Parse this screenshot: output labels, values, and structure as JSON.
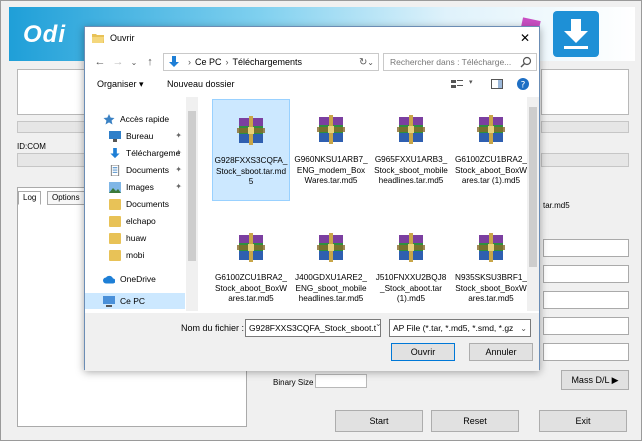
{
  "odin": {
    "logo": "Odi",
    "id_com": "ID:COM",
    "tabs": [
      "Log",
      "Options"
    ],
    "file_suffix": "tar.md5",
    "binary_size_label": "Binary Size",
    "mass_dl_label": "Mass D/L ▶",
    "start": "Start",
    "reset": "Reset",
    "exit": "Exit"
  },
  "dialog": {
    "title": "Ouvrir",
    "close": "✕",
    "nav": {
      "back": "←",
      "forward": "→",
      "up": "↑",
      "recent": "⌄",
      "path": [
        "Ce PC",
        "Téléchargements"
      ],
      "search_placeholder": "Rechercher dans : Télécharge..."
    },
    "toolbar": {
      "organize": "Organiser ▾",
      "new_folder": "Nouveau dossier"
    },
    "sidebar": [
      {
        "label": "Accès rapide",
        "icon": "star-icon",
        "pinned": false
      },
      {
        "label": "Bureau",
        "icon": "desktop-icon",
        "pinned": true
      },
      {
        "label": "Téléchargeme",
        "icon": "download-icon",
        "pinned": true
      },
      {
        "label": "Documents",
        "icon": "documents-icon",
        "pinned": true
      },
      {
        "label": "Images",
        "icon": "images-icon",
        "pinned": true
      },
      {
        "label": "Documents",
        "icon": "folder-icon",
        "pinned": false
      },
      {
        "label": "elchapo",
        "icon": "folder-icon",
        "pinned": false
      },
      {
        "label": "huaw",
        "icon": "folder-icon",
        "pinned": false
      },
      {
        "label": "mobi",
        "icon": "folder-icon",
        "pinned": false
      },
      {
        "label": "OneDrive",
        "icon": "cloud-icon",
        "pinned": false
      },
      {
        "label": "Ce PC",
        "icon": "computer-icon",
        "pinned": false,
        "selected": true
      }
    ],
    "files": [
      {
        "name": "G928FXXS3CQFA_Stock_sboot.tar.md5",
        "selected": true
      },
      {
        "name": "G960NKSU1ARB7_ENG_modem_BoxWares.tar.md5"
      },
      {
        "name": "G965FXXU1ARB3_Stock_sboot_mobileheadlines.tar.md5"
      },
      {
        "name": "G6100ZCU1BRA2_Stock_aboot_BoxWares.tar (1).md5"
      },
      {
        "name": "G6100ZCU1BRA2_Stock_aboot_BoxWares.tar.md5"
      },
      {
        "name": "J400GDXU1ARE2_ENG_sboot_mobileheadlines.tar.md5"
      },
      {
        "name": "J510FNXXU2BQJ8_Stock_aboot.tar (1).md5"
      },
      {
        "name": "N935SKSU3BRF1_Stock_sboot_BoxWares.tar.md5"
      }
    ],
    "bottom": {
      "filename_label": "Nom du fichier :",
      "filename_value": "G928FXXS3CQFA_Stock_sboot.t",
      "filter_value": "AP File (*.tar, *.md5, *.smd, *.gz",
      "open": "Ouvrir",
      "cancel": "Annuler"
    }
  },
  "colors": {
    "selection": "#cce8ff",
    "accent": "#0078d7"
  }
}
